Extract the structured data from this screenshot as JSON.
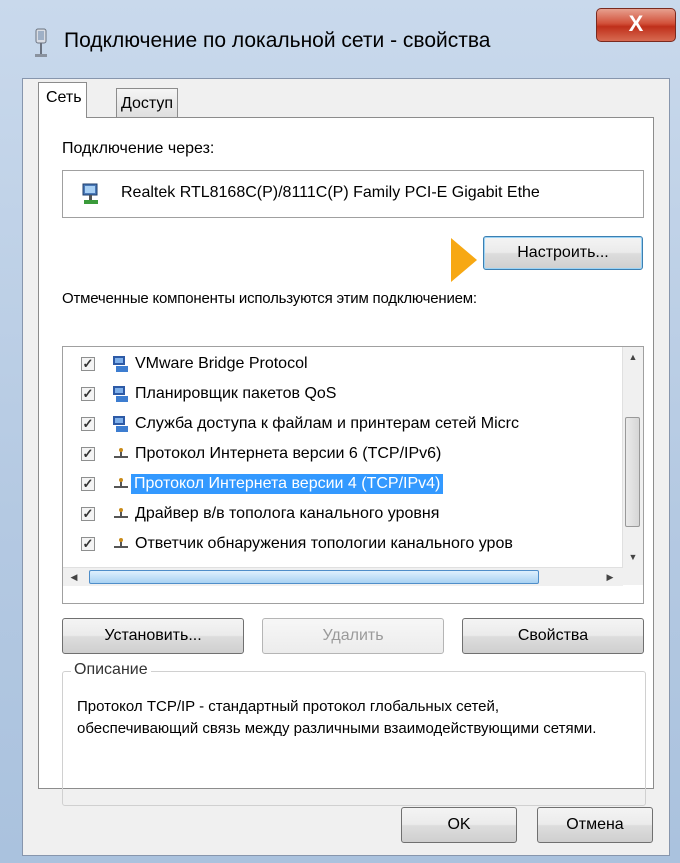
{
  "window": {
    "title": "Подключение по локальной сети - свойства",
    "close_label": "X"
  },
  "tabs": [
    {
      "label": "Сеть",
      "active": true
    },
    {
      "label": "Доступ",
      "active": false
    }
  ],
  "connect_via": {
    "label": "Подключение через:",
    "adapter_name": "Realtek RTL8168C(P)/8111C(P) Family PCI-E Gigabit Ethe",
    "configure_button": "Настроить..."
  },
  "components": {
    "label": "Отмеченные компоненты используются этим подключением:",
    "items": [
      {
        "label": "VMware Bridge Protocol",
        "checked": true,
        "icon": "network-service-icon",
        "selected": false
      },
      {
        "label": "Планировщик пакетов QoS",
        "checked": true,
        "icon": "network-service-icon",
        "selected": false
      },
      {
        "label": "Служба доступа к файлам и принтерам сетей Micrc",
        "checked": true,
        "icon": "network-service-icon",
        "selected": false
      },
      {
        "label": "Протокол Интернета версии 6 (TCP/IPv6)",
        "checked": true,
        "icon": "protocol-icon",
        "selected": false
      },
      {
        "label": "Протокол Интернета версии 4 (TCP/IPv4)",
        "checked": true,
        "icon": "protocol-icon",
        "selected": true
      },
      {
        "label": "Драйвер в/в тополога канального уровня",
        "checked": true,
        "icon": "protocol-icon",
        "selected": false
      },
      {
        "label": "Ответчик обнаружения топологии канального уров",
        "checked": true,
        "icon": "protocol-icon",
        "selected": false
      }
    ]
  },
  "actions": {
    "install": "Установить...",
    "remove": "Удалить",
    "properties": "Свойства"
  },
  "description": {
    "title": "Описание",
    "text": "Протокол TCP/IP - стандартный протокол глобальных сетей, обеспечивающий связь между различными взаимодействующими сетями."
  },
  "footer": {
    "ok": "OK",
    "cancel": "Отмена"
  },
  "colors": {
    "selection": "#3399ff",
    "marker_arrow": "#f7a813",
    "close_button": "#c9452c"
  }
}
